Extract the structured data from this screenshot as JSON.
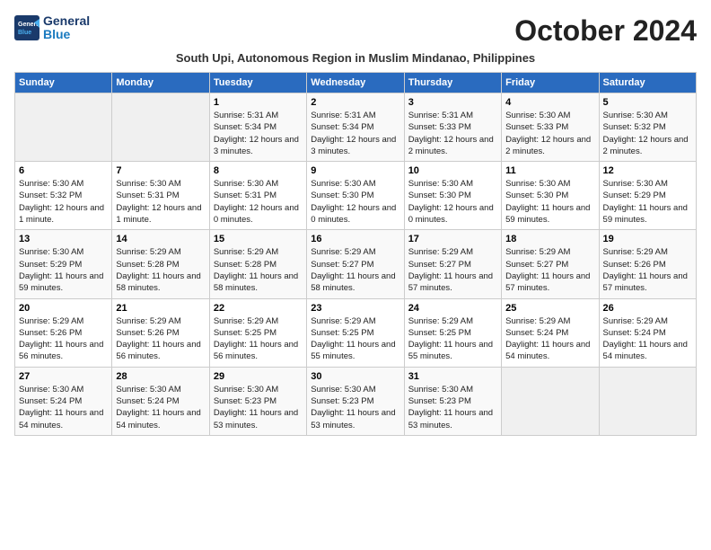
{
  "logo": {
    "line1": "General",
    "line2": "Blue"
  },
  "title": "October 2024",
  "subtitle": "South Upi, Autonomous Region in Muslim Mindanao, Philippines",
  "headers": [
    "Sunday",
    "Monday",
    "Tuesday",
    "Wednesday",
    "Thursday",
    "Friday",
    "Saturday"
  ],
  "weeks": [
    [
      {
        "day": "",
        "info": ""
      },
      {
        "day": "",
        "info": ""
      },
      {
        "day": "1",
        "info": "Sunrise: 5:31 AM\nSunset: 5:34 PM\nDaylight: 12 hours and 3 minutes."
      },
      {
        "day": "2",
        "info": "Sunrise: 5:31 AM\nSunset: 5:34 PM\nDaylight: 12 hours and 3 minutes."
      },
      {
        "day": "3",
        "info": "Sunrise: 5:31 AM\nSunset: 5:33 PM\nDaylight: 12 hours and 2 minutes."
      },
      {
        "day": "4",
        "info": "Sunrise: 5:30 AM\nSunset: 5:33 PM\nDaylight: 12 hours and 2 minutes."
      },
      {
        "day": "5",
        "info": "Sunrise: 5:30 AM\nSunset: 5:32 PM\nDaylight: 12 hours and 2 minutes."
      }
    ],
    [
      {
        "day": "6",
        "info": "Sunrise: 5:30 AM\nSunset: 5:32 PM\nDaylight: 12 hours and 1 minute."
      },
      {
        "day": "7",
        "info": "Sunrise: 5:30 AM\nSunset: 5:31 PM\nDaylight: 12 hours and 1 minute."
      },
      {
        "day": "8",
        "info": "Sunrise: 5:30 AM\nSunset: 5:31 PM\nDaylight: 12 hours and 0 minutes."
      },
      {
        "day": "9",
        "info": "Sunrise: 5:30 AM\nSunset: 5:30 PM\nDaylight: 12 hours and 0 minutes."
      },
      {
        "day": "10",
        "info": "Sunrise: 5:30 AM\nSunset: 5:30 PM\nDaylight: 12 hours and 0 minutes."
      },
      {
        "day": "11",
        "info": "Sunrise: 5:30 AM\nSunset: 5:30 PM\nDaylight: 11 hours and 59 minutes."
      },
      {
        "day": "12",
        "info": "Sunrise: 5:30 AM\nSunset: 5:29 PM\nDaylight: 11 hours and 59 minutes."
      }
    ],
    [
      {
        "day": "13",
        "info": "Sunrise: 5:30 AM\nSunset: 5:29 PM\nDaylight: 11 hours and 59 minutes."
      },
      {
        "day": "14",
        "info": "Sunrise: 5:29 AM\nSunset: 5:28 PM\nDaylight: 11 hours and 58 minutes."
      },
      {
        "day": "15",
        "info": "Sunrise: 5:29 AM\nSunset: 5:28 PM\nDaylight: 11 hours and 58 minutes."
      },
      {
        "day": "16",
        "info": "Sunrise: 5:29 AM\nSunset: 5:27 PM\nDaylight: 11 hours and 58 minutes."
      },
      {
        "day": "17",
        "info": "Sunrise: 5:29 AM\nSunset: 5:27 PM\nDaylight: 11 hours and 57 minutes."
      },
      {
        "day": "18",
        "info": "Sunrise: 5:29 AM\nSunset: 5:27 PM\nDaylight: 11 hours and 57 minutes."
      },
      {
        "day": "19",
        "info": "Sunrise: 5:29 AM\nSunset: 5:26 PM\nDaylight: 11 hours and 57 minutes."
      }
    ],
    [
      {
        "day": "20",
        "info": "Sunrise: 5:29 AM\nSunset: 5:26 PM\nDaylight: 11 hours and 56 minutes."
      },
      {
        "day": "21",
        "info": "Sunrise: 5:29 AM\nSunset: 5:26 PM\nDaylight: 11 hours and 56 minutes."
      },
      {
        "day": "22",
        "info": "Sunrise: 5:29 AM\nSunset: 5:25 PM\nDaylight: 11 hours and 56 minutes."
      },
      {
        "day": "23",
        "info": "Sunrise: 5:29 AM\nSunset: 5:25 PM\nDaylight: 11 hours and 55 minutes."
      },
      {
        "day": "24",
        "info": "Sunrise: 5:29 AM\nSunset: 5:25 PM\nDaylight: 11 hours and 55 minutes."
      },
      {
        "day": "25",
        "info": "Sunrise: 5:29 AM\nSunset: 5:24 PM\nDaylight: 11 hours and 54 minutes."
      },
      {
        "day": "26",
        "info": "Sunrise: 5:29 AM\nSunset: 5:24 PM\nDaylight: 11 hours and 54 minutes."
      }
    ],
    [
      {
        "day": "27",
        "info": "Sunrise: 5:30 AM\nSunset: 5:24 PM\nDaylight: 11 hours and 54 minutes."
      },
      {
        "day": "28",
        "info": "Sunrise: 5:30 AM\nSunset: 5:24 PM\nDaylight: 11 hours and 54 minutes."
      },
      {
        "day": "29",
        "info": "Sunrise: 5:30 AM\nSunset: 5:23 PM\nDaylight: 11 hours and 53 minutes."
      },
      {
        "day": "30",
        "info": "Sunrise: 5:30 AM\nSunset: 5:23 PM\nDaylight: 11 hours and 53 minutes."
      },
      {
        "day": "31",
        "info": "Sunrise: 5:30 AM\nSunset: 5:23 PM\nDaylight: 11 hours and 53 minutes."
      },
      {
        "day": "",
        "info": ""
      },
      {
        "day": "",
        "info": ""
      }
    ]
  ]
}
